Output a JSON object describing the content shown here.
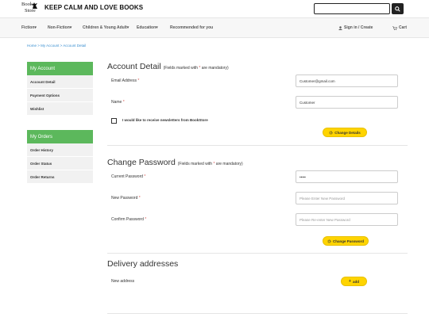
{
  "header": {
    "logo_line1": "Book",
    "logo_line2": "Store",
    "tagline": "KEEP CALM AND LOVE BOOKS",
    "search_placeholder": ""
  },
  "nav": {
    "items": [
      "Fiction▾",
      "Non-Fiction▾",
      "Children & Young Adult▾",
      "Education▾",
      "Recommended for you"
    ],
    "sign_in": "Sign in / Create",
    "cart": "Cart"
  },
  "breadcrumb": "Home > My Account > Account Detail",
  "sidebar": {
    "account_head": "My Account",
    "account_items": [
      "Account Detail",
      "Payment Options",
      "Wishlist"
    ],
    "orders_head": "My Orders",
    "order_items": [
      "Order History",
      "Order Status",
      "Order Returns"
    ]
  },
  "account_detail": {
    "title": "Account Detail",
    "hint_prefix": "(Fields marked with ",
    "hint_star": "*",
    "hint_suffix": " are mandatory)",
    "email_label": "Email Address",
    "email_value": "Customer@gmail.com",
    "name_label": "Name",
    "name_value": "Customer",
    "newsletter_label": "I would like to receive newsletters from BookStore",
    "change_details": "Change Details"
  },
  "change_password": {
    "title": "Change Password",
    "hint_prefix": "(Fields marked with ",
    "hint_star": "*",
    "hint_suffix": " are mandatory)",
    "current_label": "Current Password",
    "current_value": "•••••",
    "new_label": "New Password",
    "new_placeholder": "Please Enter New Password",
    "confirm_label": "Confirm Password",
    "confirm_placeholder": "Please Re-enter New Password",
    "button": "Change Password"
  },
  "delivery": {
    "title": "Delivery addresses",
    "new_label": "New address",
    "add_button": "add"
  },
  "required_star": "*",
  "colors": {
    "accent_green": "#5cb85c",
    "button_yellow": "#ffd400",
    "required_red": "#d9534f",
    "link_blue": "#3a8fd0"
  }
}
